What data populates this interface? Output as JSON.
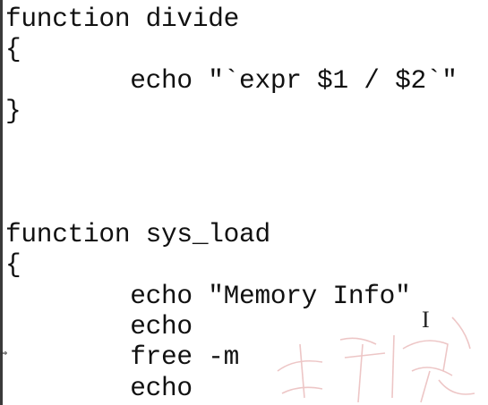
{
  "editor": {
    "lines": [
      "function divide",
      "{",
      "        echo \"`expr $1 / $2`\"",
      "}",
      "",
      "",
      "",
      "function sys_load",
      "{",
      "        echo \"Memory Info\"",
      "        echo",
      "        free -m",
      "        echo"
    ],
    "cursor_glyph": "I",
    "resize_glyph": "⇔"
  },
  "colors": {
    "background": "#ffffff",
    "text": "#111111",
    "watermark": "#e8b4b4"
  }
}
